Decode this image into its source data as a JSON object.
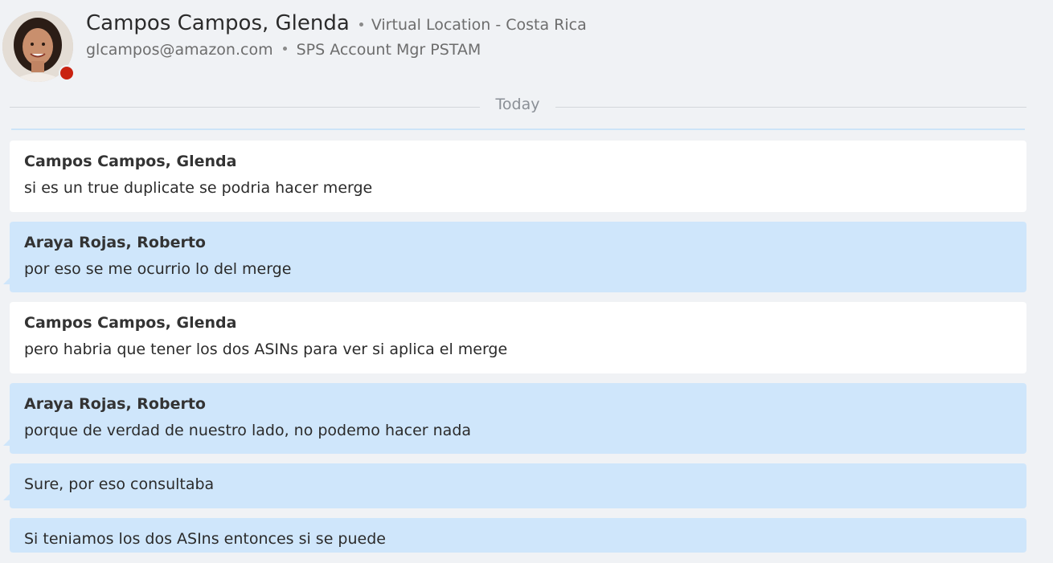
{
  "contact": {
    "name": "Campos Campos, Glenda",
    "location": "Virtual Location - Costa Rica",
    "email": "glcampos@amazon.com",
    "title": "SPS Account Mgr PSTAM",
    "status_color": "#c92210"
  },
  "divider": {
    "label": "Today"
  },
  "colors": {
    "background": "#f0f2f5",
    "incoming_bubble": "#ffffff",
    "outgoing_bubble": "#cfe6fb"
  },
  "messages": [
    {
      "sender": "Campos Campos, Glenda",
      "text": "si es un true duplicate se podria hacer merge"
    },
    {
      "sender": "Araya Rojas, Roberto",
      "text": "por eso se me ocurrio lo del merge"
    },
    {
      "sender": "Campos Campos, Glenda",
      "text": "pero habria que tener los dos ASINs para ver si aplica el merge"
    },
    {
      "sender": "Araya Rojas, Roberto",
      "text": "porque de verdad de nuestro lado, no podemo hacer nada"
    },
    {
      "sender": "",
      "text": "Sure, por eso consultaba"
    },
    {
      "sender": "",
      "text": "Si teniamos los dos ASIns entonces si se puede"
    }
  ]
}
